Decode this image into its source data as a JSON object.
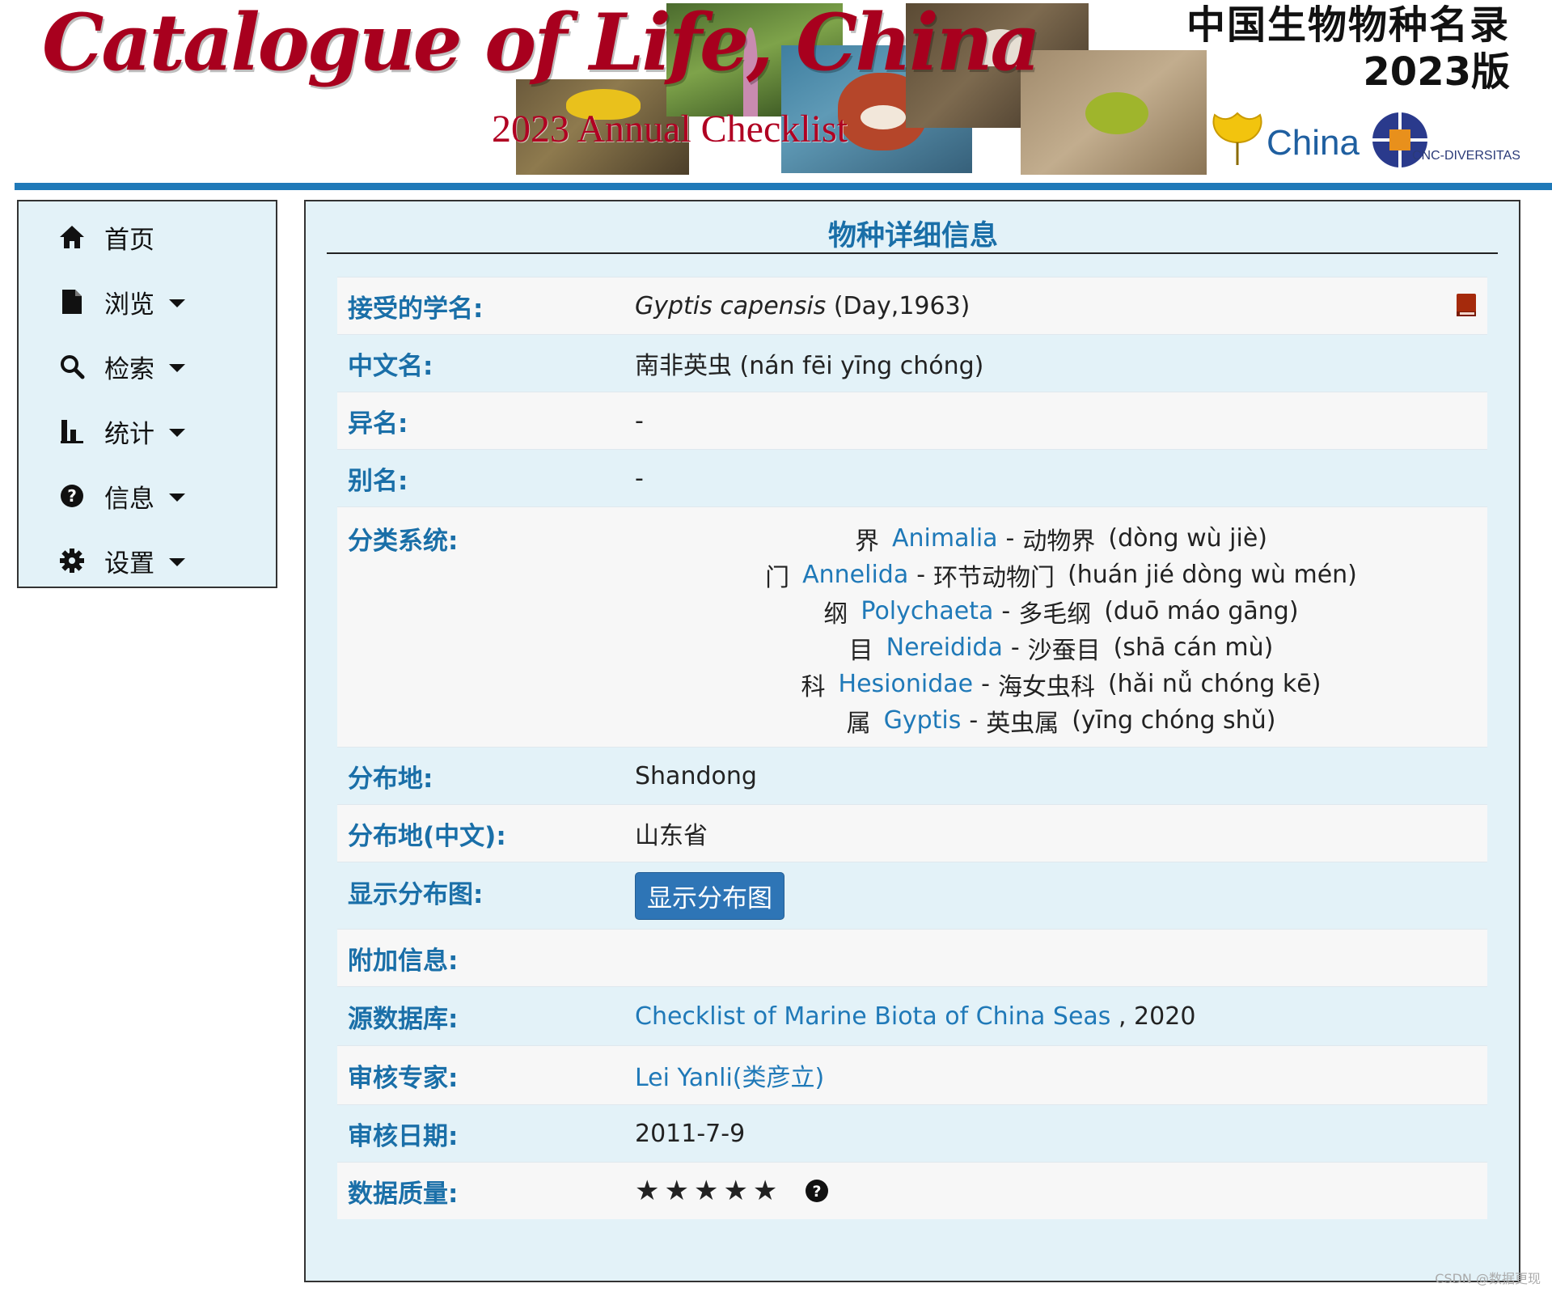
{
  "banner": {
    "title": "Catalogue of Life, China",
    "subtitle": "2023 Annual Checklist",
    "cn_title_line1": "中国生物物种名录",
    "cn_title_line2": "2023版",
    "logo_china": "China",
    "logo_cnc": "CNC-DIVERSITAS"
  },
  "sidebar": {
    "items": [
      {
        "label": "首页",
        "icon": "home-icon",
        "has_caret": false
      },
      {
        "label": "浏览",
        "icon": "file-icon",
        "has_caret": true
      },
      {
        "label": "检索",
        "icon": "search-icon",
        "has_caret": true
      },
      {
        "label": "统计",
        "icon": "bar-chart-icon",
        "has_caret": true
      },
      {
        "label": "信息",
        "icon": "question-circle-icon",
        "has_caret": true
      },
      {
        "label": "设置",
        "icon": "gear-icon",
        "has_caret": true
      }
    ]
  },
  "main": {
    "title": "物种详细信息",
    "accepted_name": {
      "label": "接受的学名:",
      "genus_species": "Gyptis capensis",
      "author": "(Day,1963)"
    },
    "chinese_name": {
      "label": "中文名:",
      "value": "南非英虫 (nán fēi yīng chóng)"
    },
    "synonyms": {
      "label": "异名:",
      "value": "-"
    },
    "common_names": {
      "label": "别名:",
      "value": "-"
    },
    "taxonomy": {
      "label": "分类系统:",
      "ranks": [
        {
          "rank": "界",
          "latin": "Animalia",
          "sep": "-",
          "cn": "动物界",
          "pinyin": "(dòng wù jiè)"
        },
        {
          "rank": "门",
          "latin": "Annelida",
          "sep": "-",
          "cn": "环节动物门",
          "pinyin": "(huán jié dòng wù mén)"
        },
        {
          "rank": "纲",
          "latin": "Polychaeta",
          "sep": "-",
          "cn": "多毛纲",
          "pinyin": "(duō máo gāng)"
        },
        {
          "rank": "目",
          "latin": "Nereidida",
          "sep": "-",
          "cn": "沙蚕目",
          "pinyin": "(shā cán mù)"
        },
        {
          "rank": "科",
          "latin": "Hesionidae",
          "sep": "-",
          "cn": "海女虫科",
          "pinyin": "(hǎi nǚ chóng kē)"
        },
        {
          "rank": "属",
          "latin": "Gyptis",
          "sep": "-",
          "cn": "英虫属",
          "pinyin": "(yīng chóng shǔ)"
        }
      ]
    },
    "distribution": {
      "label": "分布地:",
      "value": "Shandong"
    },
    "distribution_cn": {
      "label": "分布地(中文):",
      "value": "山东省"
    },
    "show_map": {
      "label": "显示分布图:",
      "button": "显示分布图"
    },
    "additional_info": {
      "label": "附加信息:",
      "value": ""
    },
    "source_db": {
      "label": "源数据库:",
      "link": "Checklist of Marine Biota of China Seas",
      "suffix": ", 2020"
    },
    "reviewer": {
      "label": "审核专家:",
      "value": "Lei Yanli(类彦立)"
    },
    "review_date": {
      "label": "审核日期:",
      "value": "2011-7-9"
    },
    "data_quality": {
      "label": "数据质量:",
      "stars": 5,
      "star_glyphs": "★★★★★"
    }
  },
  "watermark": "CSDN @数据更现"
}
